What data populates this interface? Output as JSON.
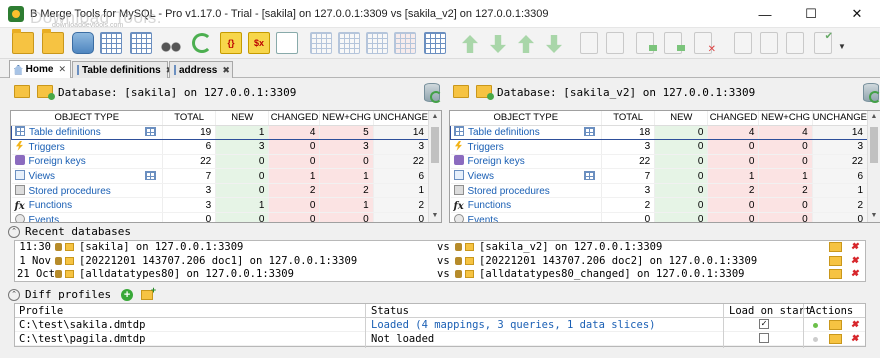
{
  "window": {
    "title": "dbForge DB Merge Tools for MySQL - Pro v1.17.0 - Trial - [sakila] on 127.0.0.1:3309 vs [sakila_v2] on 127.0.0.1:3309",
    "title_visible": "B Merge Tools for MySQL - Pro v1.17.0 - Trial - [sakila] on 127.0.0.1:3309 vs [sakila_v2] on 127.0.0.1:3309",
    "watermark": "Download Tools.",
    "watermark_sub": "downloaddevtools.com"
  },
  "tabs": [
    {
      "label": "Home",
      "icon": "home-icon",
      "active": true
    },
    {
      "label": "Table definitions",
      "icon": "table-icon",
      "active": false
    },
    {
      "label": "address",
      "icon": "table-icon",
      "active": false
    }
  ],
  "columns": [
    "OBJECT TYPE",
    "TOTAL",
    "NEW",
    "CHANGED",
    "NEW+CHG",
    "UNCHANGED"
  ],
  "left": {
    "db_label": "Database: [sakila] on 127.0.0.1:3309",
    "rows": [
      {
        "name": "Table definitions",
        "icon": "table-icon",
        "total": "19",
        "new": "1",
        "changed": "4",
        "newchg": "5",
        "unchanged": "14"
      },
      {
        "name": "Triggers",
        "icon": "trigger-icon",
        "total": "6",
        "new": "3",
        "changed": "0",
        "newchg": "3",
        "unchanged": "3"
      },
      {
        "name": "Foreign keys",
        "icon": "foreign-key-icon",
        "total": "22",
        "new": "0",
        "changed": "0",
        "newchg": "0",
        "unchanged": "22"
      },
      {
        "name": "Views",
        "icon": "view-icon",
        "total": "7",
        "new": "0",
        "changed": "1",
        "newchg": "1",
        "unchanged": "6"
      },
      {
        "name": "Stored procedures",
        "icon": "procedure-icon",
        "total": "3",
        "new": "0",
        "changed": "2",
        "newchg": "2",
        "unchanged": "1"
      },
      {
        "name": "Functions",
        "icon": "function-icon",
        "total": "3",
        "new": "1",
        "changed": "0",
        "newchg": "1",
        "unchanged": "2"
      },
      {
        "name": "Events",
        "icon": "event-icon",
        "total": "0",
        "new": "0",
        "changed": "0",
        "newchg": "0",
        "unchanged": "0"
      }
    ]
  },
  "right": {
    "db_label": "Database: [sakila_v2] on 127.0.0.1:3309",
    "rows": [
      {
        "name": "Table definitions",
        "icon": "table-icon",
        "total": "18",
        "new": "0",
        "changed": "4",
        "newchg": "4",
        "unchanged": "14"
      },
      {
        "name": "Triggers",
        "icon": "trigger-icon",
        "total": "3",
        "new": "0",
        "changed": "0",
        "newchg": "0",
        "unchanged": "3"
      },
      {
        "name": "Foreign keys",
        "icon": "foreign-key-icon",
        "total": "22",
        "new": "0",
        "changed": "0",
        "newchg": "0",
        "unchanged": "22"
      },
      {
        "name": "Views",
        "icon": "view-icon",
        "total": "7",
        "new": "0",
        "changed": "1",
        "newchg": "1",
        "unchanged": "6"
      },
      {
        "name": "Stored procedures",
        "icon": "procedure-icon",
        "total": "3",
        "new": "0",
        "changed": "2",
        "newchg": "2",
        "unchanged": "1"
      },
      {
        "name": "Functions",
        "icon": "function-icon",
        "total": "2",
        "new": "0",
        "changed": "0",
        "newchg": "0",
        "unchanged": "2"
      },
      {
        "name": "Events",
        "icon": "event-icon",
        "total": "0",
        "new": "0",
        "changed": "0",
        "newchg": "0",
        "unchanged": "0"
      }
    ]
  },
  "recent": {
    "title": "Recent databases",
    "vs": "vs",
    "rows": [
      {
        "time": "11:30",
        "left": "[sakila] on 127.0.0.1:3309",
        "right": "[sakila_v2] on 127.0.0.1:3309"
      },
      {
        "time": "1 Nov",
        "left": "[20221201 143707.206 doc1] on 127.0.0.1:3309",
        "right": "[20221201 143707.206 doc2] on 127.0.0.1:3309"
      },
      {
        "time": "21 Oct",
        "left": "[alldatatypes80] on 127.0.0.1:3309",
        "right": "[alldatatypes80_changed] on 127.0.0.1:3309"
      }
    ]
  },
  "profiles": {
    "title": "Diff profiles",
    "headers": {
      "profile": "Profile",
      "status": "Status",
      "load": "Load on start",
      "actions": "Actions"
    },
    "rows": [
      {
        "profile": "C:\\test\\sakila.dmtdp",
        "status": "Loaded (4 mappings, 3 queries, 1 data slices)",
        "load_on_start": true
      },
      {
        "profile": "C:\\test\\pagila.dmtdp",
        "status": "Not loaded",
        "load_on_start": false
      }
    ]
  }
}
